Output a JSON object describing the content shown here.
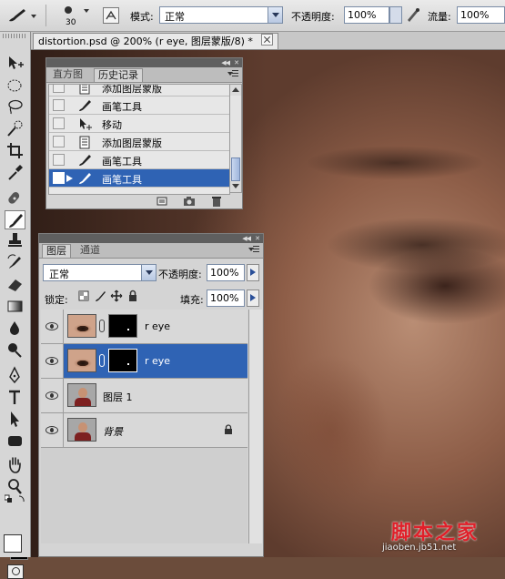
{
  "options_bar": {
    "brush_size": "30",
    "mode_label": "模式:",
    "mode_value": "正常",
    "opacity_label": "不透明度:",
    "opacity_value": "100%",
    "flow_label": "流量:",
    "flow_value": "100%"
  },
  "document": {
    "tab_title": "distortion.psd @ 200% (r eye, 图层蒙版/8) *"
  },
  "history_panel": {
    "tabs": [
      "直方图",
      "历史记录"
    ],
    "active_tab": "历史记录",
    "items": [
      {
        "label": "添加图层蒙版",
        "icon": "document-icon",
        "selected": false
      },
      {
        "label": "画笔工具",
        "icon": "brush-icon",
        "selected": false
      },
      {
        "label": "移动",
        "icon": "move-icon",
        "selected": false
      },
      {
        "label": "添加图层蒙版",
        "icon": "document-icon",
        "selected": false
      },
      {
        "label": "画笔工具",
        "icon": "brush-icon",
        "selected": false
      },
      {
        "label": "画笔工具",
        "icon": "brush-icon",
        "selected": true
      }
    ]
  },
  "layers_panel": {
    "tabs": [
      "图层",
      "通道"
    ],
    "active_tab": "图层",
    "blend_mode": "正常",
    "opacity_label": "不透明度:",
    "opacity_value": "100%",
    "lock_label": "锁定:",
    "fill_label": "填充:",
    "fill_value": "100%",
    "layers": [
      {
        "name": "r eye",
        "has_mask": true,
        "selected": false,
        "thumbnail": "eye-photo"
      },
      {
        "name": "r eye",
        "has_mask": true,
        "selected": true,
        "thumbnail": "eye-photo"
      },
      {
        "name": "图层 1",
        "has_mask": false,
        "selected": false,
        "thumbnail": "person"
      },
      {
        "name": "背景",
        "has_mask": false,
        "selected": false,
        "thumbnail": "person",
        "italic": true,
        "locked": true
      }
    ]
  },
  "colors": {
    "selection_blue": "#2f63b4",
    "foreground": "#ffffff",
    "background": "#000000"
  },
  "watermark": {
    "text": "脚本之家",
    "url": "jiaoben.jb51.net"
  }
}
